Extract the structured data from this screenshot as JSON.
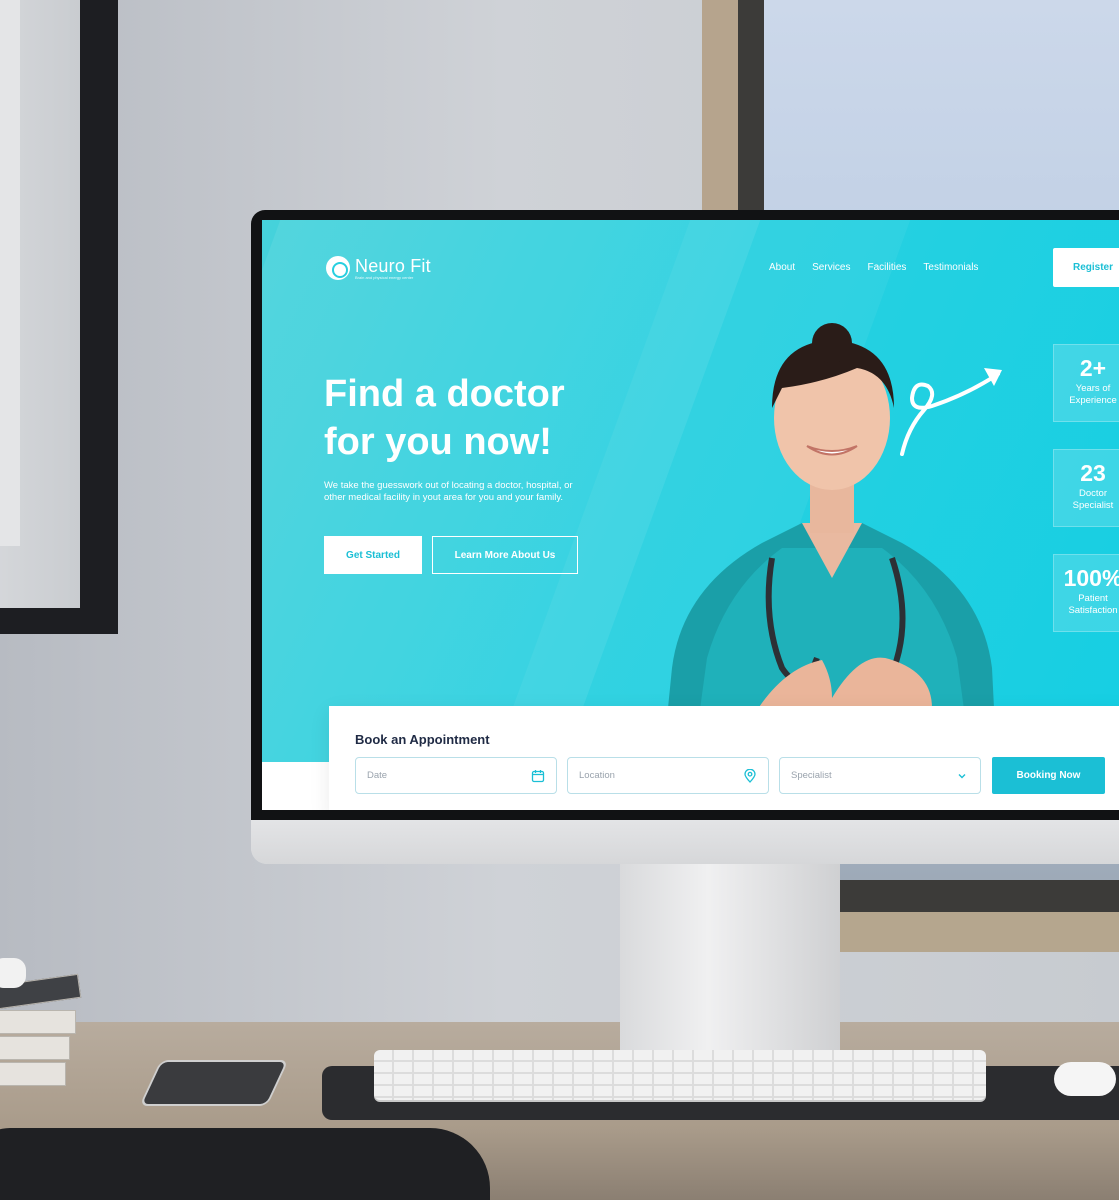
{
  "brand": {
    "name": "Neuro Fit",
    "tagline": "Brain and physical energy center"
  },
  "nav": {
    "items": [
      "About",
      "Services",
      "Facilities",
      "Testimonials"
    ],
    "register_label": "Register"
  },
  "hero": {
    "headline_line1": "Find a doctor",
    "headline_line2": "for you now!",
    "subtext": "We take the guesswork out of locating a doctor, hospital, or other medical facility in yout area for you and your family.",
    "primary_button": "Get Started",
    "secondary_button": "Learn More About Us"
  },
  "stats": [
    {
      "value": "2+",
      "label_line1": "Years of",
      "label_line2": "Experience"
    },
    {
      "value": "23",
      "label_line1": "Doctor",
      "label_line2": "Specialist"
    },
    {
      "value": "100%",
      "label_line1": "Patient",
      "label_line2": "Satisfaction"
    }
  ],
  "booking": {
    "title": "Book an Appointment",
    "date_placeholder": "Date",
    "location_placeholder": "Location",
    "specialist_placeholder": "Specialist",
    "button_label": "Booking Now",
    "icons": [
      "calendar-icon",
      "location-pin-icon",
      "chevron-down-icon"
    ]
  },
  "colors": {
    "accent": "#1bbfd5",
    "hero_start": "#46d2db",
    "hero_end": "#16cfe3",
    "heading_dark": "#1f2a44"
  }
}
